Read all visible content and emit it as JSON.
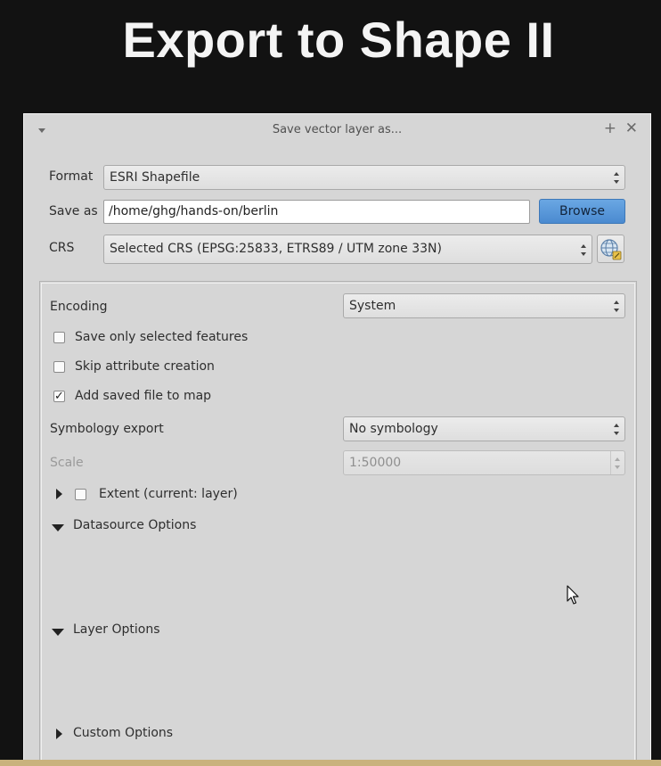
{
  "slide": {
    "title": "Export to Shape II"
  },
  "dialog": {
    "title": "Save vector layer as...",
    "pin_icon": "+",
    "close_icon": "✕",
    "format": {
      "label": "Format",
      "value": "ESRI Shapefile"
    },
    "save_as": {
      "label": "Save as",
      "value": "/home/ghg/hands-on/berlin",
      "browse_label": "Browse"
    },
    "crs": {
      "label": "CRS",
      "value": "Selected CRS (EPSG:25833, ETRS89 / UTM zone 33N)"
    },
    "encoding": {
      "label": "Encoding",
      "value": "System"
    },
    "options": {
      "save_selected": {
        "label": "Save only selected features",
        "checked": false
      },
      "skip_attribute": {
        "label": "Skip attribute creation",
        "checked": false
      },
      "add_to_map": {
        "label": "Add saved file to map",
        "checked": true
      }
    },
    "symbology": {
      "label": "Symbology export",
      "value": "No symbology"
    },
    "scale": {
      "label": "Scale",
      "value": "1:50000"
    },
    "extent": {
      "label": "Extent (current: layer)",
      "checked": false
    },
    "sections": {
      "datasource": "Datasource Options",
      "layer": "Layer Options",
      "custom": "Custom Options"
    }
  },
  "colors": {
    "accent": "#4a8ad0",
    "dialog_bg": "#d6d6d6",
    "page_bg": "#121212",
    "bottom_line": "#c9b27d"
  }
}
